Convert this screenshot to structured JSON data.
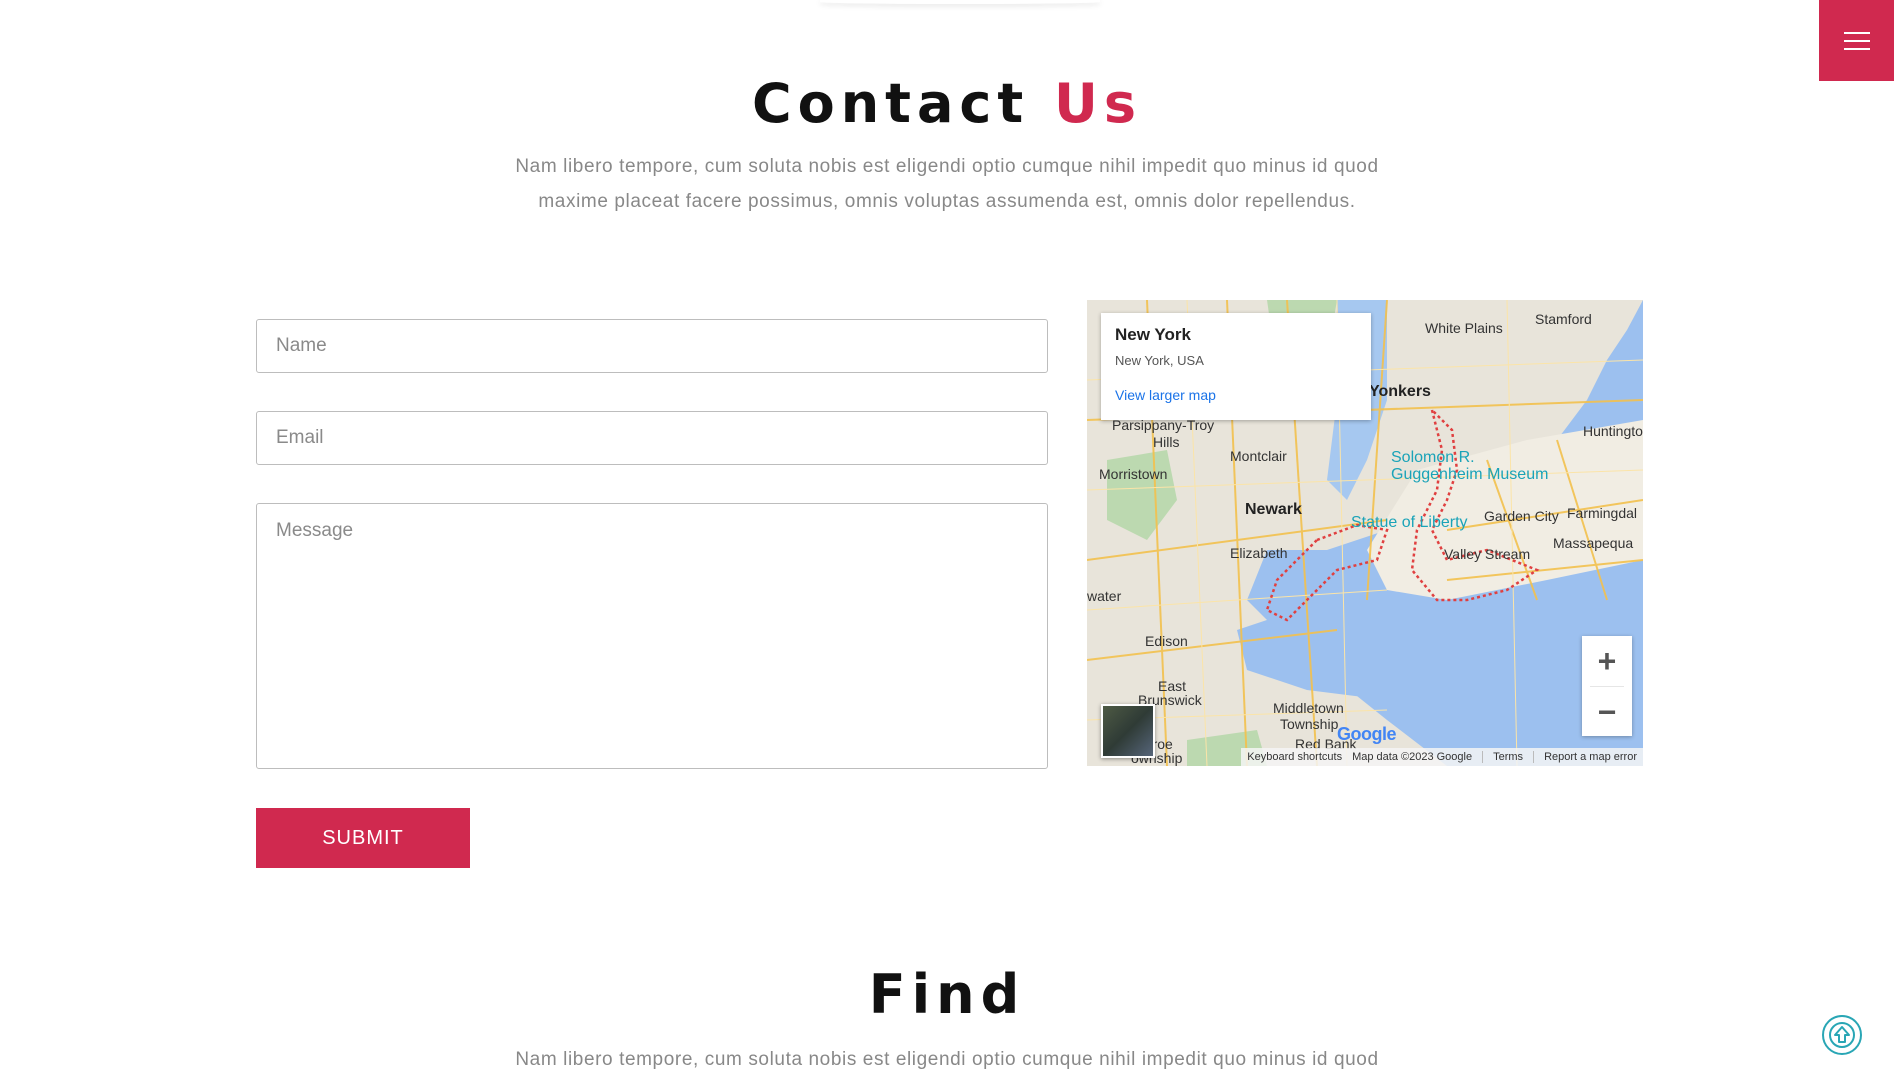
{
  "menu": {
    "icon": "hamburger-menu-icon",
    "color": "#d0294f"
  },
  "contact": {
    "title_main": "Contact",
    "title_accent": "Us",
    "description": "Nam libero tempore, cum soluta nobis est eligendi optio cumque nihil impedit quo minus id quod maxime placeat facere possimus, omnis voluptas assumenda est, omnis dolor repellendus."
  },
  "form": {
    "name_placeholder": "Name",
    "email_placeholder": "Email",
    "message_placeholder": "Message",
    "submit_label": "SUBMIT"
  },
  "map": {
    "place_title": "New York",
    "place_subtitle": "New York, USA",
    "view_larger": "View larger map",
    "labels": {
      "white_plains": "White Plains",
      "stamford": "Stamford",
      "yonkers": "Yonkers",
      "huntington": "Huntingto",
      "parsippany": "Parsippany-Troy",
      "hills": "Hills",
      "montclair": "Montclair",
      "morristown": "Morristown",
      "newark": "Newark",
      "guggenheim1": "Solomon R.",
      "guggenheim2": "Guggenheim Museum",
      "statue": "Statue of Liberty",
      "garden_city": "Garden City",
      "farmingdale": "Farmingdal",
      "massapequa": "Massapequa",
      "elizabeth": "Elizabeth",
      "valley_stream": "Valley Stream",
      "water": "water",
      "edison": "Edison",
      "east_brunswick1": "East",
      "east_brunswick2": "Brunswick",
      "middletown1": "Middletown",
      "middletown2": "Township",
      "red_bank": "Red Bank",
      "monroe1": "onroe",
      "monroe2": "ownship"
    },
    "zoom_in": "+",
    "zoom_out": "−",
    "google_logo": "Google",
    "attribution": {
      "shortcuts": "Keyboard shortcuts",
      "map_data": "Map data ©2023 Google",
      "terms": "Terms",
      "report": "Report a map error"
    }
  },
  "find": {
    "title": "Find",
    "description": "Nam libero tempore, cum soluta nobis est eligendi optio cumque nihil impedit quo minus id quod"
  },
  "scroll_top": {
    "icon": "arrow-up-circle-icon",
    "color": "#29a6b5"
  }
}
